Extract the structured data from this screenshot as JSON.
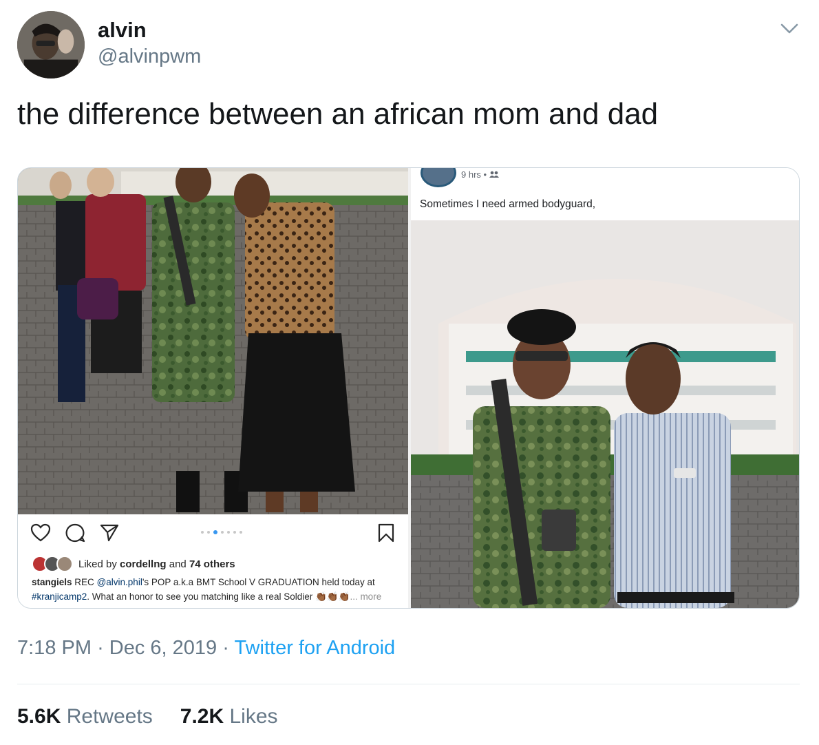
{
  "user": {
    "display_name": "alvin",
    "handle": "@alvinpwm"
  },
  "tweet": {
    "text": "the difference between an african mom and dad",
    "time": "7:18 PM",
    "separator": "·",
    "date": "Dec 6, 2019",
    "source": "Twitter for Android"
  },
  "instagram": {
    "liked_by_prefix": "Liked by",
    "liked_by_user": "cordellng",
    "liked_by_and": "and",
    "liked_by_others": "74 others",
    "caption_user": "stangiels",
    "caption_part1": "REC",
    "caption_mention": "@alvin.phil",
    "caption_part2": "'s POP a.k.a BMT School V GRADUATION held today at",
    "caption_hashtag": "#kranjicamp2",
    "caption_part3": ". What an honor to see you matching like a real Soldier",
    "caption_emoji": "👏🏾👏🏾👏🏾",
    "caption_more": "... more",
    "carousel_dots": 7,
    "carousel_active": 2
  },
  "facebook": {
    "time": "9 hrs",
    "privacy": "•",
    "post_text": "Sometimes I need armed bodyguard,"
  },
  "stats": {
    "retweets_count": "5.6K",
    "retweets_label": "Retweets",
    "likes_count": "7.2K",
    "likes_label": "Likes"
  },
  "colors": {
    "link": "#1da1f2",
    "muted": "#657786",
    "text": "#14171a",
    "ig_active_dot": "#3897f0"
  }
}
